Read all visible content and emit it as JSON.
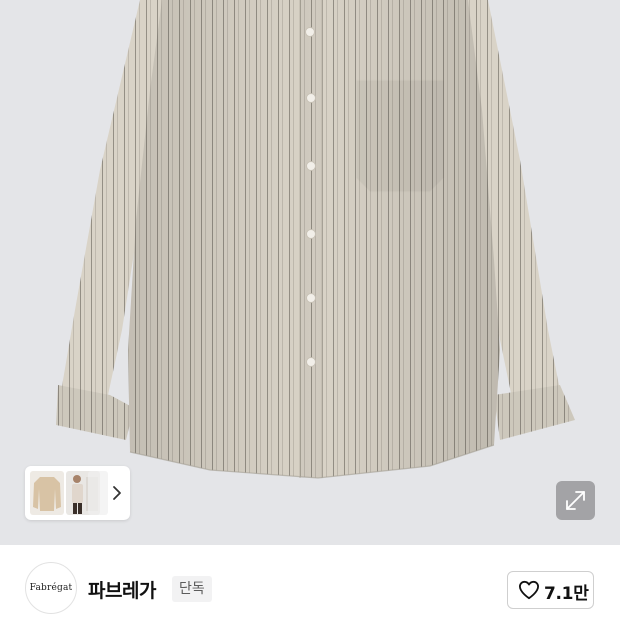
{
  "product_gallery": {
    "image_description_icon": "striped-shirt-image",
    "thumbnails": [
      "thumbnail-shirt-beige",
      "thumbnail-model",
      "thumbnail-shirt-white"
    ],
    "expand_icon": "expand-diagonal-icon",
    "next_icon": "chevron-right-icon"
  },
  "brand": {
    "logo_text": "Fabrégat",
    "name": "파브레가",
    "badge": "단독"
  },
  "like": {
    "icon": "heart-outline-icon",
    "count": "7.1만"
  },
  "colors": {
    "background_gray": "#e4e5e8",
    "shirt": "#d8d2c6",
    "stripe": "#8f8a80"
  }
}
